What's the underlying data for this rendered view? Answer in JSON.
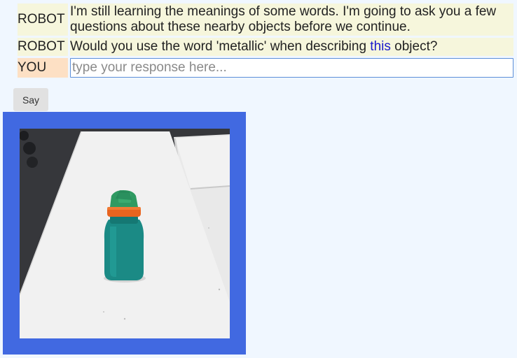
{
  "dialog": {
    "turns": [
      {
        "speaker": "ROBOT",
        "text": "I'm still learning the meanings of some words. I'm going to ask you a few questions about these nearby objects before we continue."
      },
      {
        "speaker": "ROBOT",
        "text_before": "Would you use the word 'metallic' when describing ",
        "link_text": "this",
        "text_after": " object?"
      }
    ],
    "you_label": "YOU",
    "input_placeholder": "type your response here...",
    "input_value": ""
  },
  "say_button_label": "Say",
  "photo": {
    "subject": "teal water bottle with green cap and orange ring on a white table",
    "frame_color": "#4169e1",
    "bottle_color": "#1b8a85",
    "cap_color": "#2f9a62",
    "ring_color": "#e8641f"
  }
}
